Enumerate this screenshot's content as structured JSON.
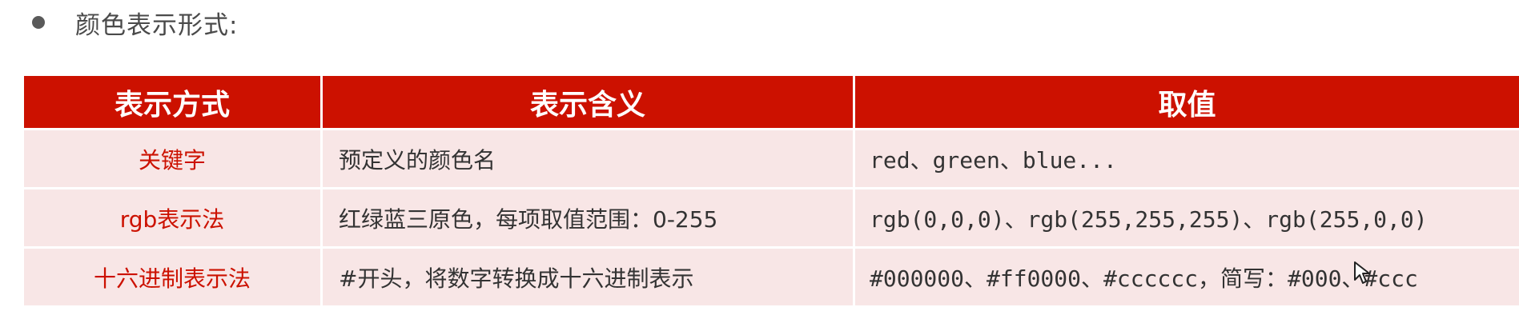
{
  "heading": {
    "text": "颜色表示形式:"
  },
  "table": {
    "headers": [
      "表示方式",
      "表示含义",
      "取值"
    ],
    "rows": [
      {
        "method": "关键字",
        "meaning": "预定义的颜色名",
        "value": "red、green、blue..."
      },
      {
        "method": "rgb表示法",
        "meaning": "红绿蓝三原色，每项取值范围：0-255",
        "value": "rgb(0,0,0)、rgb(255,255,255)、rgb(255,0,0)"
      },
      {
        "method": "十六进制表示法",
        "meaning": "#开头，将数字转换成十六进制表示",
        "value": "#000000、#ff0000、#cccccc，简写：#000、#ccc"
      }
    ]
  },
  "colors": {
    "header_bg": "#cc1100",
    "row_bg": "#f8e6e6",
    "method_text": "#cc1100"
  },
  "icons": {
    "bullet": "bullet-dot-icon",
    "cursor": "mouse-cursor-icon"
  }
}
